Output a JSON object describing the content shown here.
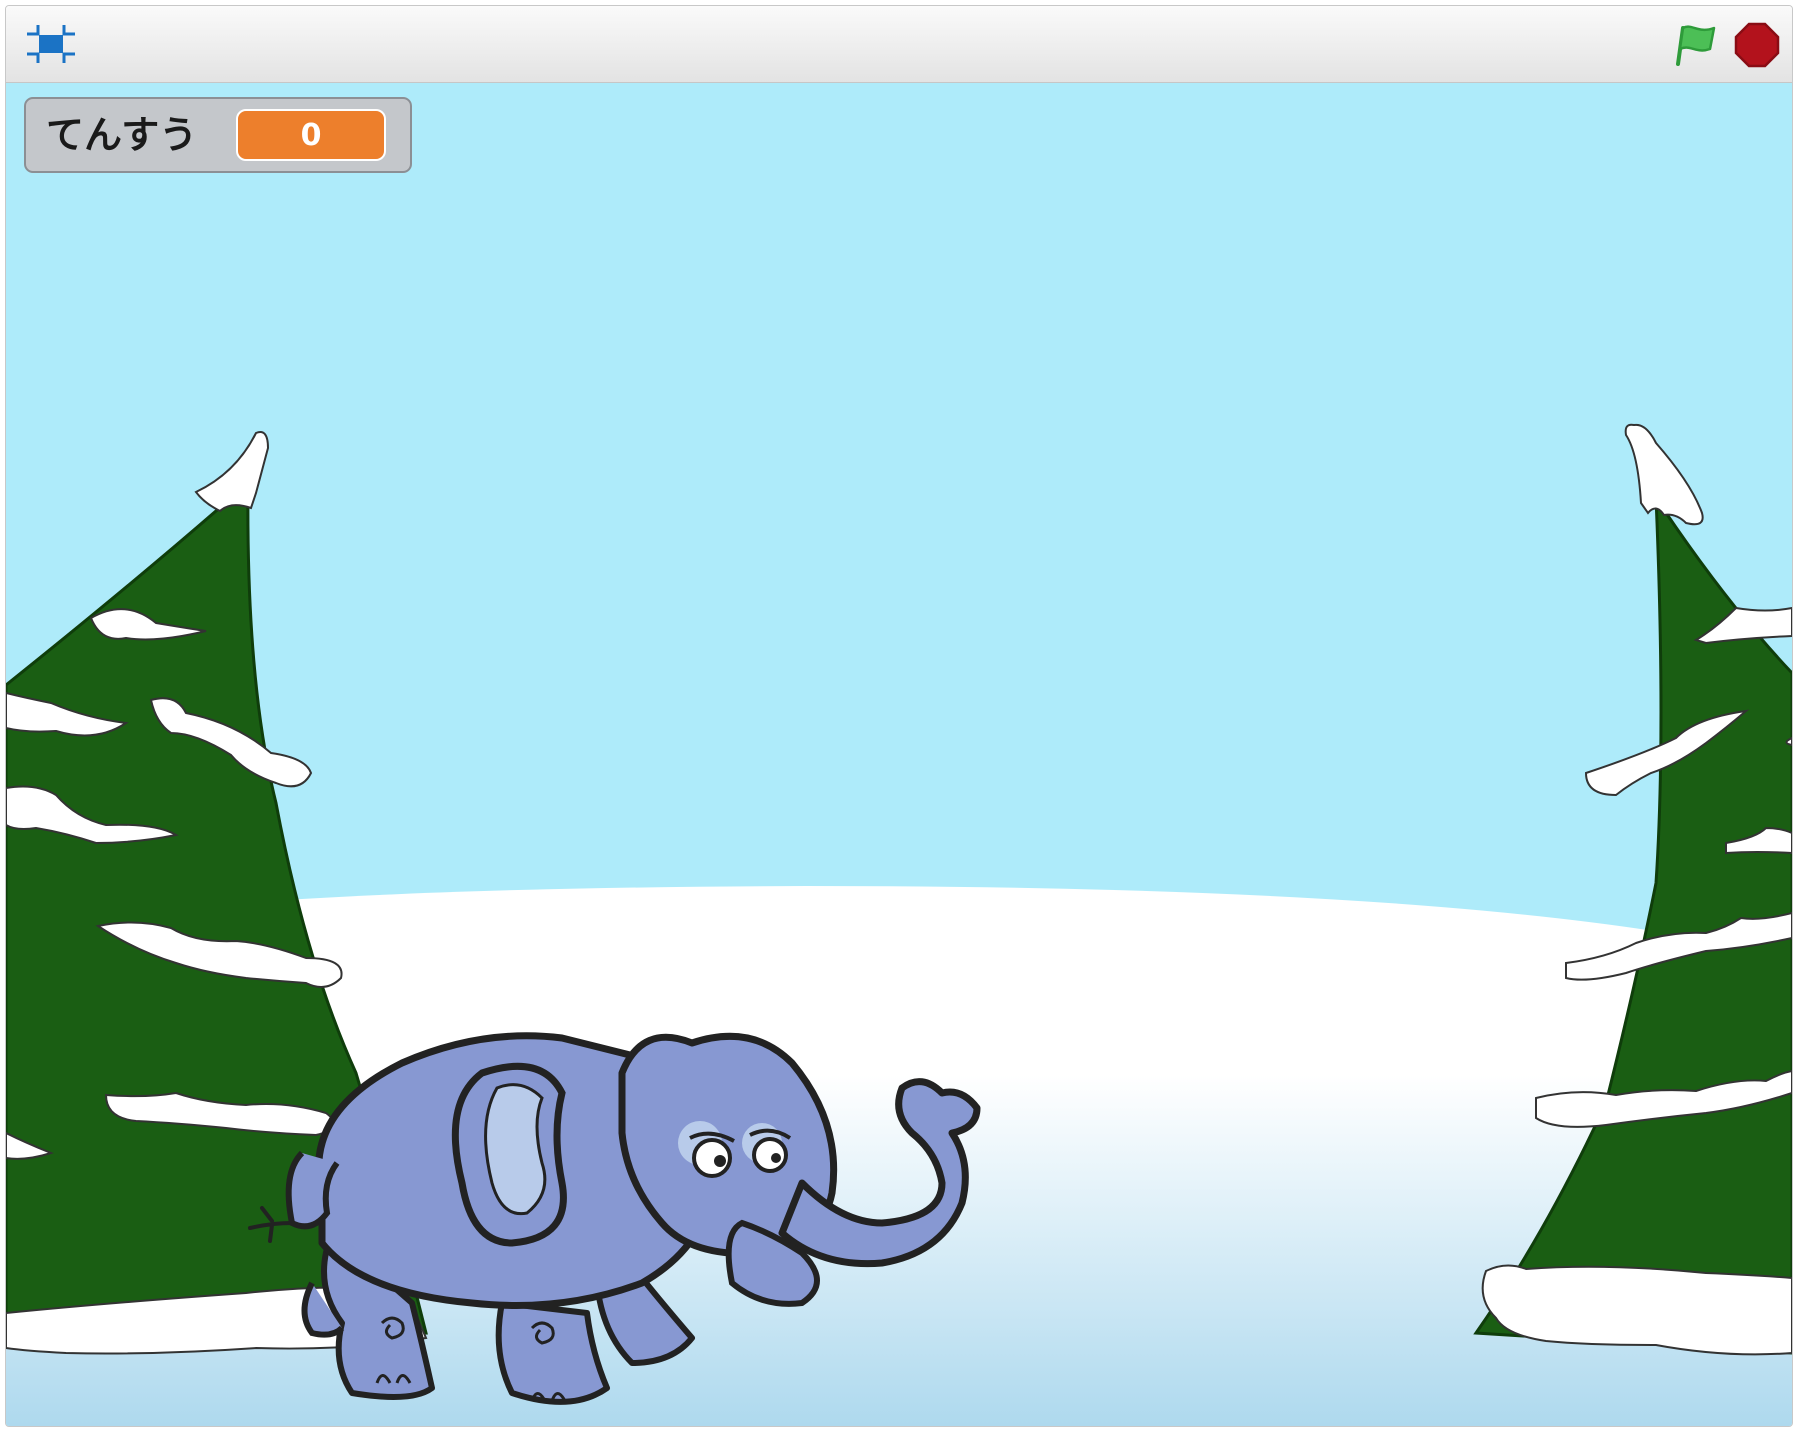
{
  "toolbar": {
    "fullscreen_icon": "fullscreen-icon",
    "green_flag_icon": "green-flag-icon",
    "stop_icon": "stop-sign-icon"
  },
  "monitor": {
    "label": "てんすう",
    "value": "0"
  },
  "stage": {
    "sprite": "elephant",
    "backdrop": "winter"
  },
  "colors": {
    "sky": "#aeebfa",
    "tree": "#1a5e13",
    "snow": "#ffffff",
    "monitor_value_bg": "#ed7f2c",
    "flag": "#4cbf56",
    "stop": "#b3121c",
    "elephant": "#8798d2"
  }
}
